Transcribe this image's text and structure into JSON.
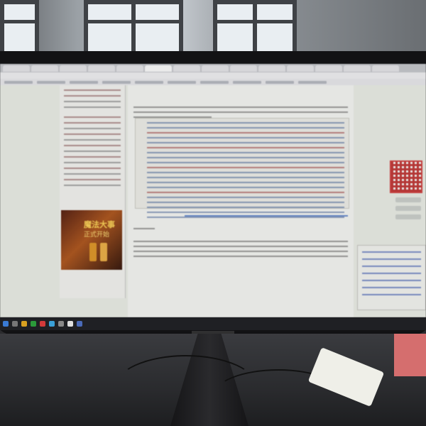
{
  "scene": {
    "description_free": true,
    "colors": {
      "bezel": "#121214",
      "screen_bg": "#dfe3dc",
      "ad_accent": "#ffd65a",
      "qr_red": "#c02828",
      "taskbar": "#1f2024"
    }
  },
  "browser": {
    "url": "",
    "tabs_count": 20
  },
  "ad_banner": {
    "line1": "魔法大事",
    "line2": "正式开始"
  },
  "icons": [
    "windows-logo-icon",
    "taskbar-app-icon",
    "qr-code-icon"
  ]
}
